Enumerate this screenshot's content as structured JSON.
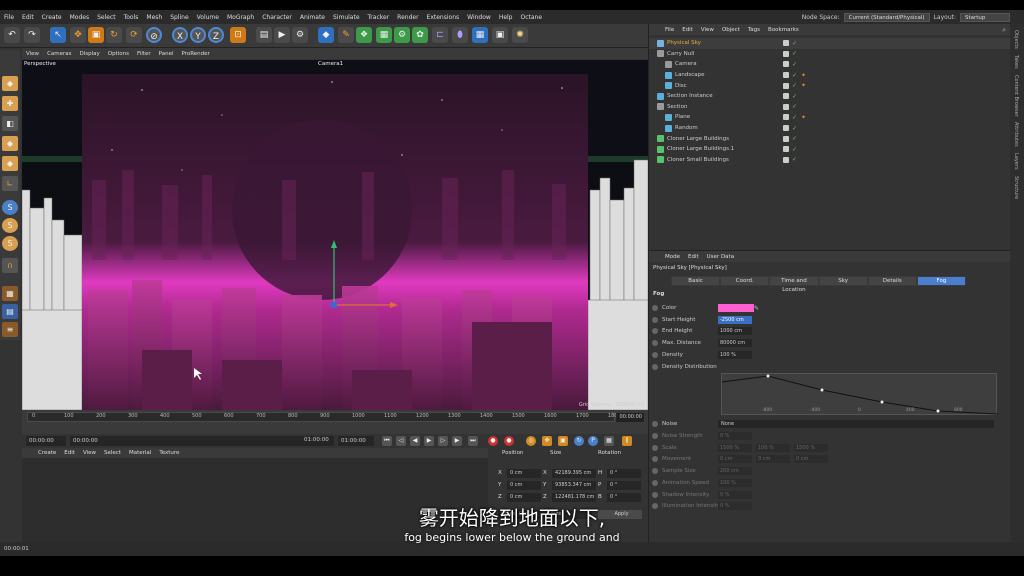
{
  "menu": [
    "File",
    "Edit",
    "Create",
    "Modes",
    "Select",
    "Tools",
    "Mesh",
    "Spline",
    "Volume",
    "MoGraph",
    "Character",
    "Animate",
    "Simulate",
    "Tracker",
    "Render",
    "Extensions",
    "Window",
    "Help",
    "Octane"
  ],
  "nodespace": {
    "label": "Node Space:",
    "value": "Current (Standard/Physical)",
    "layout_label": "Layout:",
    "layout_value": "Startup"
  },
  "viewport": {
    "menu": [
      "View",
      "Cameras",
      "Display",
      "Options",
      "Filter",
      "Panel",
      "ProRender"
    ],
    "name": "Perspective",
    "camera": "Camera1",
    "grid": "Grid Spacing : 100000 cm"
  },
  "timeline": {
    "ticks": [
      "0",
      "100",
      "200",
      "300",
      "400",
      "500",
      "600",
      "700",
      "800",
      "900",
      "1000",
      "1100",
      "1200",
      "1300",
      "1400",
      "1500",
      "1600",
      "1700",
      "1800"
    ],
    "frame": "00:00:00"
  },
  "transport": {
    "start": "00:00:00",
    "current": "00:00:00",
    "end": "01:00:00",
    "max": "01:00:00"
  },
  "material": {
    "menu": [
      "Create",
      "Edit",
      "View",
      "Select",
      "Material",
      "Texture"
    ]
  },
  "coords": {
    "headers": [
      "Position",
      "Size",
      "Rotation"
    ],
    "rows": [
      {
        "axis": "X",
        "pos": "0 cm",
        "size_axis": "X",
        "size": "42189.395 cm",
        "rot_axis": "H",
        "rot": "0 °"
      },
      {
        "axis": "Y",
        "pos": "0 cm",
        "size_axis": "Y",
        "size": "93853.347 cm",
        "rot_axis": "P",
        "rot": "0 °"
      },
      {
        "axis": "Z",
        "pos": "0 cm",
        "size_axis": "Z",
        "size": "122481.178 cm",
        "rot_axis": "B",
        "rot": "0 °"
      }
    ],
    "mode": "Object (Rel)",
    "size_mode": "Size",
    "apply": "Apply"
  },
  "objects": {
    "menu": [
      "File",
      "Edit",
      "View",
      "Object",
      "Tags",
      "Bookmarks"
    ],
    "items": [
      {
        "name": "Physical Sky",
        "indent": 0,
        "color": "#7ab0e0",
        "highlight": true
      },
      {
        "name": "Carry Null",
        "indent": 0,
        "color": "#9a9a9a"
      },
      {
        "name": "Camera",
        "indent": 1,
        "color": "#9a9a9a"
      },
      {
        "name": "Landscape",
        "indent": 1,
        "color": "#5ab0d8",
        "tag": true
      },
      {
        "name": "Disc",
        "indent": 1,
        "color": "#5ab0d8",
        "tag": true
      },
      {
        "name": "Section Instance",
        "indent": 0,
        "color": "#5ab0d8"
      },
      {
        "name": "Section",
        "indent": 0,
        "color": "#9a9a9a"
      },
      {
        "name": "Plane",
        "indent": 1,
        "color": "#5ab0d8",
        "tag": true
      },
      {
        "name": "Random",
        "indent": 1,
        "color": "#5ab0d8"
      },
      {
        "name": "Cloner Large Buildings",
        "indent": 0,
        "color": "#5ac26a"
      },
      {
        "name": "Cloner Large Buildings.1",
        "indent": 0,
        "color": "#5ac26a"
      },
      {
        "name": "Cloner Small Buildings",
        "indent": 0,
        "color": "#5ac26a"
      }
    ]
  },
  "attributes": {
    "menu": [
      "Mode",
      "Edit",
      "User Data"
    ],
    "title": "Physical Sky [Physical Sky]",
    "tabs": [
      "Basic",
      "Coord.",
      "Time and Location",
      "Sky",
      "Details",
      "Fog"
    ],
    "active_tab": "Fog",
    "section": "Fog",
    "rows": [
      {
        "label": "Color",
        "value": "",
        "swatch": "#ff5fd0"
      },
      {
        "label": "Start Height",
        "value": "-2500 cm",
        "selected": true
      },
      {
        "label": "End Height",
        "value": "1000 cm"
      },
      {
        "label": "Max. Distance",
        "value": "80000 cm"
      },
      {
        "label": "Density",
        "value": "100 %"
      },
      {
        "label": "Density Distribution",
        "value": ""
      }
    ],
    "graph_labels": [
      "-800",
      "-400",
      "0",
      "400",
      "800"
    ],
    "noise": {
      "label": "Noise",
      "value": "None"
    },
    "noise_rows": [
      {
        "label": "Noise Strength",
        "v1": "0 %"
      },
      {
        "label": "Scale",
        "v1": "1500 %",
        "v2": "100 %",
        "v3": "1500 %"
      },
      {
        "label": "Movement",
        "v1": "0 cm",
        "v2": "0 cm",
        "v3": "0 cm"
      },
      {
        "label": "Sample Size",
        "v1": "200 cm"
      },
      {
        "label": "Animation Speed",
        "v1": "100 %"
      },
      {
        "label": "Shadow Intensity",
        "v1": "0 %"
      },
      {
        "label": "Illumination Intensity",
        "v1": "0 %"
      }
    ]
  },
  "sidebar_tabs": [
    "Objects",
    "Takes",
    "Content Browser",
    "Attributes",
    "Layers",
    "Structure"
  ],
  "status": "00:00:01",
  "subtitle": {
    "zh": "雾开始降到地面以下,",
    "en": "fog begins lower below the ground and"
  }
}
